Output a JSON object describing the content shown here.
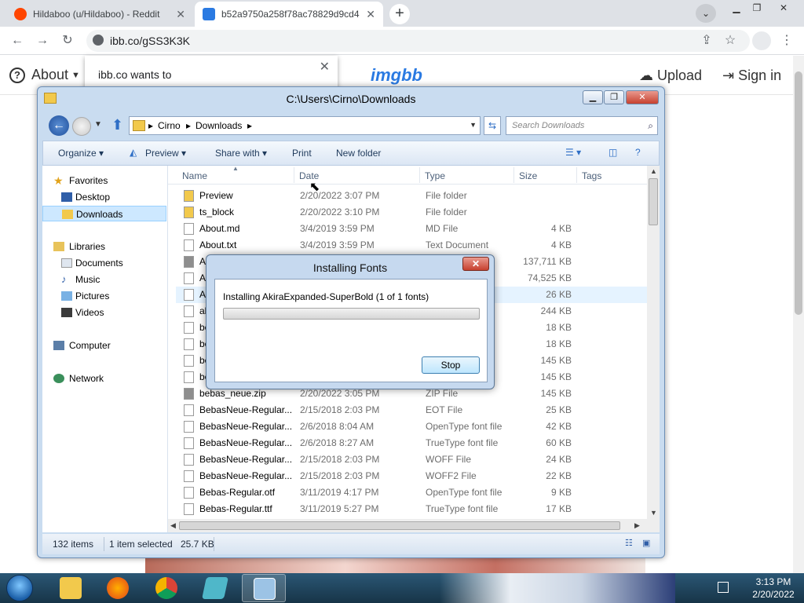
{
  "browser": {
    "tabs": [
      {
        "title": "Hildaboo (u/Hildaboo) - Reddit",
        "active": false
      },
      {
        "title": "b52a9750a258f78ac78829d9cd4",
        "active": true
      }
    ],
    "url": "ibb.co/gSS3K3K"
  },
  "site": {
    "about_label": "About",
    "logo": "imgbb",
    "upload_label": "Upload",
    "signin_label": "Sign in",
    "notification": "ibb.co wants to"
  },
  "explorer": {
    "title": "C:\\Users\\Cirno\\Downloads",
    "breadcrumb": [
      "Cirno",
      "Downloads"
    ],
    "search_placeholder": "Search Downloads",
    "commands": [
      "Organize",
      "Preview",
      "Share with",
      "Print",
      "New folder"
    ],
    "nav": {
      "favorites": "Favorites",
      "desktop": "Desktop",
      "downloads": "Downloads",
      "libraries": "Libraries",
      "documents": "Documents",
      "music": "Music",
      "pictures": "Pictures",
      "videos": "Videos",
      "computer": "Computer",
      "network": "Network"
    },
    "columns": {
      "name": "Name",
      "date": "Date",
      "type": "Type",
      "size": "Size",
      "tags": "Tags"
    },
    "rows": [
      {
        "name": "Preview",
        "date": "2/20/2022 3:07 PM",
        "type": "File folder",
        "size": ""
      },
      {
        "name": "ts_block",
        "date": "2/20/2022 3:10 PM",
        "type": "File folder",
        "size": ""
      },
      {
        "name": "About.md",
        "date": "3/4/2019 3:59 PM",
        "type": "MD File",
        "size": "4 KB"
      },
      {
        "name": "About.txt",
        "date": "3/4/2019 3:59 PM",
        "type": "Text Document",
        "size": "4 KB"
      },
      {
        "name": "AdbeRdr11000_mui...",
        "date": "",
        "type": "ZIP File",
        "size": "137,711 KB"
      },
      {
        "name": "Adb",
        "date": "",
        "type": "",
        "size": "74,525 KB"
      },
      {
        "name": "Ak",
        "date": "",
        "type": "file",
        "size": "26 KB"
      },
      {
        "name": "aki",
        "date": "",
        "type": "",
        "size": "244 KB"
      },
      {
        "name": "beb",
        "date": "",
        "type": "",
        "size": "18 KB"
      },
      {
        "name": "beb",
        "date": "",
        "type": "",
        "size": "18 KB"
      },
      {
        "name": "beb",
        "date": "",
        "type": "",
        "size": "145 KB"
      },
      {
        "name": "beb",
        "date": "",
        "type": "",
        "size": "145 KB"
      },
      {
        "name": "bebas_neue.zip",
        "date": "2/20/2022 3:05 PM",
        "type": "ZIP File",
        "size": "145 KB"
      },
      {
        "name": "BebasNeue-Regular...",
        "date": "2/15/2018 2:03 PM",
        "type": "EOT File",
        "size": "25 KB"
      },
      {
        "name": "BebasNeue-Regular...",
        "date": "2/6/2018 8:04 AM",
        "type": "OpenType font file",
        "size": "42 KB"
      },
      {
        "name": "BebasNeue-Regular...",
        "date": "2/6/2018 8:27 AM",
        "type": "TrueType font file",
        "size": "60 KB"
      },
      {
        "name": "BebasNeue-Regular...",
        "date": "2/15/2018 2:03 PM",
        "type": "WOFF File",
        "size": "24 KB"
      },
      {
        "name": "BebasNeue-Regular...",
        "date": "2/15/2018 2:03 PM",
        "type": "WOFF2 File",
        "size": "22 KB"
      },
      {
        "name": "Bebas-Regular.otf",
        "date": "3/11/2019 4:17 PM",
        "type": "OpenType font file",
        "size": "9 KB"
      },
      {
        "name": "Bebas-Regular.ttf",
        "date": "3/11/2019 5:27 PM",
        "type": "TrueType font file",
        "size": "17 KB"
      }
    ],
    "status_items": "132 items",
    "status_selected": "1 item selected",
    "status_size": "25.7 KB"
  },
  "dialog": {
    "title": "Installing Fonts",
    "message": "Installing AkiraExpanded-SuperBold (1 of 1 fonts)",
    "stop_label": "Stop",
    "progress": 0.0
  },
  "taskbar": {
    "time": "3:13 PM",
    "date": "2/20/2022"
  }
}
